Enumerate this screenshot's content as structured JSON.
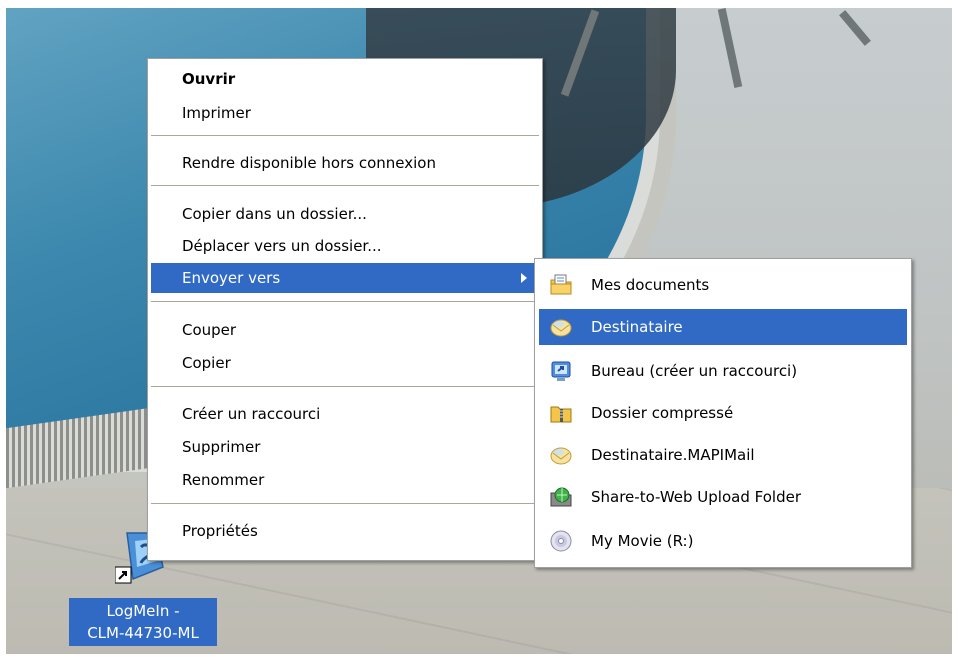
{
  "context_menu": {
    "items": [
      {
        "label": "Ouvrir"
      },
      {
        "label": "Imprimer"
      },
      {
        "label": "Rendre disponible hors connexion"
      },
      {
        "label": "Copier dans un dossier..."
      },
      {
        "label": "Déplacer vers un dossier..."
      },
      {
        "label": "Envoyer vers"
      },
      {
        "label": "Couper"
      },
      {
        "label": "Copier"
      },
      {
        "label": "Créer un raccourci"
      },
      {
        "label": "Supprimer"
      },
      {
        "label": "Renommer"
      },
      {
        "label": "Propriétés"
      }
    ],
    "highlight_color": "#316ac5"
  },
  "send_to_menu": {
    "items": [
      {
        "label": "Mes documents",
        "icon": "my-documents-icon"
      },
      {
        "label": "Destinataire",
        "icon": "mail-recipient-icon"
      },
      {
        "label": "Bureau (créer un raccourci)",
        "icon": "desktop-shortcut-icon"
      },
      {
        "label": "Dossier compressé",
        "icon": "compressed-folder-icon"
      },
      {
        "label": "Destinataire.MAPIMail",
        "icon": "mapi-mail-icon"
      },
      {
        "label": "Share-to-Web Upload Folder",
        "icon": "web-upload-folder-icon"
      },
      {
        "label": "My Movie (R:)",
        "icon": "cd-drive-icon"
      }
    ]
  },
  "desktop_icon": {
    "label_line1": "LogMeIn -",
    "label_line2": "CLM-44730-ML",
    "icon": "logmein-shortcut-icon"
  }
}
